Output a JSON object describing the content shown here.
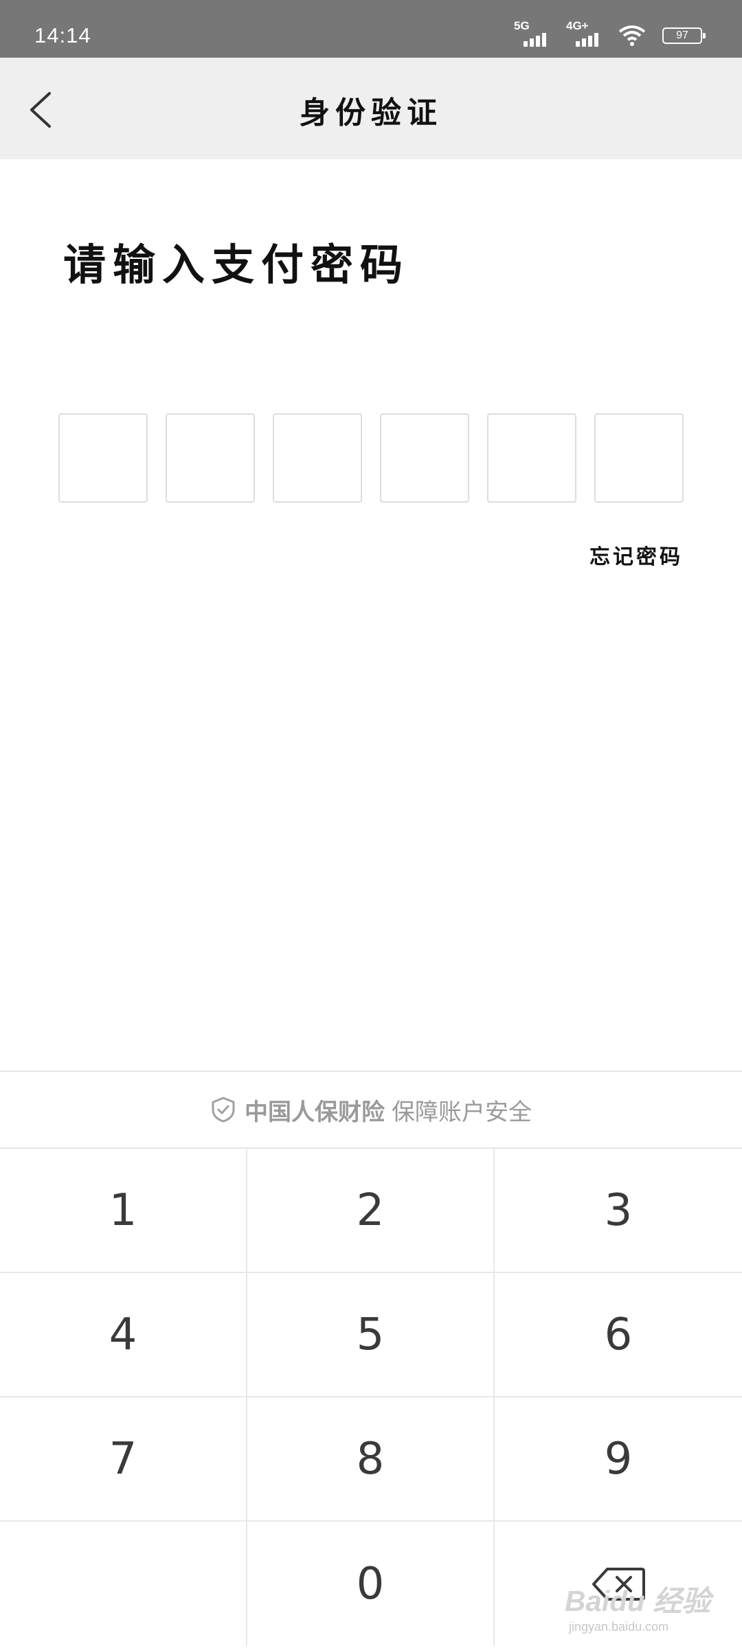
{
  "status_bar": {
    "time": "14:14",
    "signal_1_label": "5G",
    "signal_2_label": "4G+",
    "battery": "97"
  },
  "nav": {
    "title": "身份验证",
    "back_icon": "chevron-left-icon"
  },
  "prompt": {
    "title": "请输入支付密码",
    "pin_length": 6,
    "forgot_label": "忘记密码"
  },
  "keyboard": {
    "security_brand": "中国人保财险",
    "security_text": "保障账户安全",
    "security_icon": "shield-check-icon",
    "keys": [
      "1",
      "2",
      "3",
      "4",
      "5",
      "6",
      "7",
      "8",
      "9",
      "",
      "0",
      "delete"
    ],
    "delete_icon": "backspace-icon"
  },
  "watermark": {
    "main": "Baidu 经验",
    "sub": "jingyan.baidu.com"
  },
  "colors": {
    "status_bar_bg": "#777777",
    "nav_bar_bg": "#efefef",
    "key_text": "#3a3a3a",
    "divider": "#e4e4e4"
  }
}
